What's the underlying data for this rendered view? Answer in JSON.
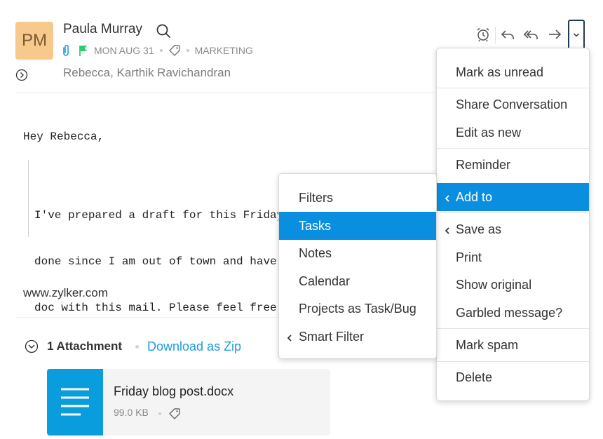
{
  "header": {
    "avatar_initials": "PM",
    "sender_name": "Paula Murray",
    "date": "MON AUG 31",
    "label": "MARKETING",
    "recipients": "Rebecca, Karthik Ravichandran",
    "flag_color": "#2ecc71",
    "attachment_icon_color": "#1a9de0"
  },
  "toolbar": {
    "icons": [
      "alarm-clock-icon",
      "reply-icon",
      "reply-all-icon",
      "forward-icon",
      "chevron-down-icon"
    ]
  },
  "body": {
    "greeting": "Hey Rebecca,",
    "quote_lines": [
      "I've prepared a draft for this Friday's b",
      "done since I am out of town and have",
      "doc with this mail. Please feel free to r"
    ],
    "website": "www.zylker.com"
  },
  "attachments": {
    "count_label": "1 Attachment",
    "download_label": "Download as Zip",
    "file": {
      "name": "Friday blog post.docx",
      "size": "99.0 KB",
      "thumb_color": "#0a9ddd"
    }
  },
  "main_menu": {
    "items": [
      {
        "label": "Mark as unread"
      },
      {
        "label": "Share Conversation"
      },
      {
        "label": "Edit as new"
      },
      {
        "label": "Reminder"
      },
      {
        "label": "Add to",
        "active": true,
        "has_submenu": true
      },
      {
        "label": "Save as",
        "has_submenu": true
      },
      {
        "label": "Print"
      },
      {
        "label": "Show original"
      },
      {
        "label": "Garbled message?"
      },
      {
        "label": "Mark spam"
      },
      {
        "label": "Delete"
      }
    ]
  },
  "sub_menu": {
    "items": [
      {
        "label": "Filters"
      },
      {
        "label": "Tasks",
        "active": true
      },
      {
        "label": "Notes"
      },
      {
        "label": "Calendar"
      },
      {
        "label": "Projects as Task/Bug"
      },
      {
        "label": "Smart Filter",
        "has_submenu": true
      }
    ]
  },
  "colors": {
    "accent": "#0a8fe0",
    "avatar_bg": "#f8c98d"
  }
}
